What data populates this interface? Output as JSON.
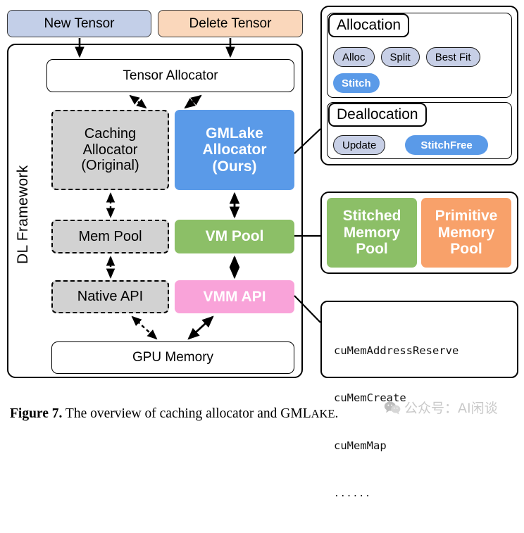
{
  "figure": {
    "caption_label": "Figure 7.",
    "caption_text": " The overview of caching allocator and GML",
    "caption_smallcaps": "AKE",
    "caption_end": "."
  },
  "watermark": {
    "text": "公众号：AI闲谈",
    "icon": "wechat-icon"
  },
  "top_banners": {
    "new_tensor": "New Tensor",
    "delete_tensor": "Delete Tensor"
  },
  "framework": {
    "side_label": "DL Framework",
    "tensor_allocator": "Tensor Allocator",
    "caching_allocator": "Caching\nAllocator\n(Original)",
    "caching_allocator_lines": [
      "Caching",
      "Allocator",
      "(Original)"
    ],
    "gmlake_allocator_lines": [
      "GMLake",
      "Allocator",
      "(Ours)"
    ],
    "mem_pool": "Mem Pool",
    "vm_pool": "VM Pool",
    "native_api": "Native API",
    "vmm_api": "VMM API",
    "gpu_memory": "GPU Memory"
  },
  "panel_alloc": {
    "allocation_title": "Allocation",
    "allocation_pills": [
      {
        "label": "Alloc",
        "style": "plain"
      },
      {
        "label": "Split",
        "style": "plain"
      },
      {
        "label": "Best Fit",
        "style": "plain"
      },
      {
        "label": "Stitch",
        "style": "accent"
      }
    ],
    "deallocation_title": "Deallocation",
    "deallocation_pills": [
      {
        "label": "Update",
        "style": "plain"
      },
      {
        "label": "StitchFree",
        "style": "accent"
      }
    ]
  },
  "panel_pools": {
    "stitched_lines": [
      "Stitched",
      "Memory",
      "Pool"
    ],
    "primitive_lines": [
      "Primitive",
      "Memory",
      "Pool"
    ]
  },
  "panel_api": {
    "calls": [
      "cuMemAddressReserve",
      "cuMemCreate",
      "cuMemMap"
    ],
    "ellipsis": "......"
  },
  "colors": {
    "new_tensor_bg": "#c3cfe8",
    "delete_tensor_bg": "#fad7bb",
    "gmlake_blue": "#5a9ae8",
    "vm_pool_green": "#8cbf67",
    "vmm_api_pink": "#f9a3d9",
    "primitive_orange": "#f8a16a",
    "dashed_gray": "#d2d2d2",
    "pill_plain": "#c7cfe6"
  }
}
